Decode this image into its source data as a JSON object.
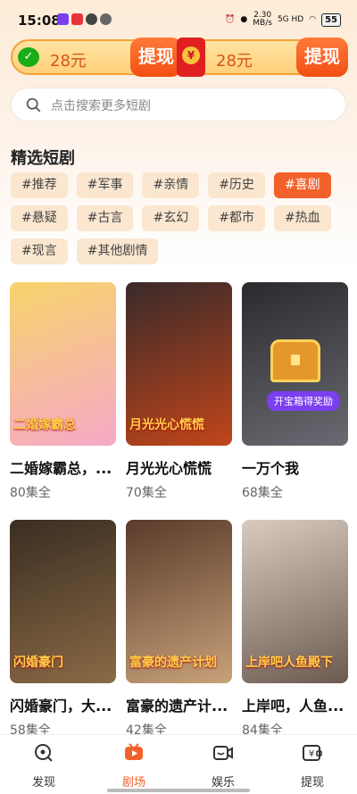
{
  "status_bar": {
    "time": "15:08",
    "net_speed": "2.30",
    "net_unit": "MB/s",
    "signal": "5G HD",
    "battery": "55"
  },
  "rewards": [
    {
      "amount": "28元",
      "button": "提现",
      "icon": "wechat-icon"
    },
    {
      "amount": "28元",
      "button": "提现",
      "icon": "red-envelope-icon"
    }
  ],
  "search": {
    "placeholder": "点击搜索更多短剧"
  },
  "section": {
    "title": "精选短剧"
  },
  "tags": [
    "#推荐",
    "#军事",
    "#亲情",
    "#历史",
    "#喜剧",
    "#悬疑",
    "#古言",
    "#玄幻",
    "#都市",
    "#热血",
    "#现言",
    "#其他剧情"
  ],
  "active_tag": "#喜剧",
  "dramas": [
    {
      "title": "二婚嫁霸总，...",
      "episodes": "80集全",
      "poster_text": "二婚嫁霸总",
      "colors": [
        "#f7d36b",
        "#f6a9c8"
      ]
    },
    {
      "title": "月光光心慌慌",
      "episodes": "70集全",
      "poster_text": "月光光心慌慌",
      "colors": [
        "#3a2a2a",
        "#c0451a"
      ]
    },
    {
      "title": "一万个我",
      "episodes": "68集全",
      "poster_text": "",
      "colors": [
        "#2a2a2e",
        "#6a6a72"
      ],
      "badge": "开宝箱得奖励"
    },
    {
      "title": "闪婚豪门，大...",
      "episodes": "58集全",
      "poster_text": "闪婚豪门",
      "colors": [
        "#3a2d22",
        "#8a6a45"
      ]
    },
    {
      "title": "富豪的遗产计...",
      "episodes": "42集全",
      "poster_text": "富豪的遗产计划",
      "colors": [
        "#5a3a2a",
        "#c7a27a"
      ]
    },
    {
      "title": "上岸吧，人鱼...",
      "episodes": "84集全",
      "poster_text": "上岸吧人鱼殿下",
      "colors": [
        "#d9cbc0",
        "#6b5a50"
      ]
    }
  ],
  "nav": [
    {
      "label": "发现",
      "icon": "discover-icon"
    },
    {
      "label": "剧场",
      "icon": "theater-icon"
    },
    {
      "label": "娱乐",
      "icon": "entertainment-icon"
    },
    {
      "label": "提现",
      "icon": "withdraw-icon"
    }
  ],
  "active_nav": "剧场",
  "colors": {
    "accent": "#f3612b",
    "tag_bg": "#fbe6cf",
    "reward_btn": "#f24f12"
  }
}
